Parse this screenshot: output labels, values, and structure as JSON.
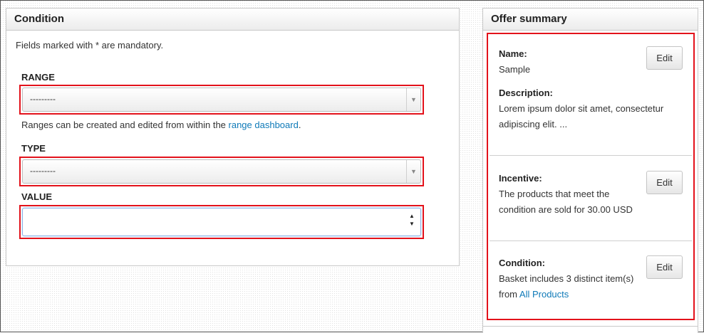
{
  "condition_panel": {
    "title": "Condition",
    "mandatory_note": "Fields marked with * are mandatory.",
    "range": {
      "label": "RANGE",
      "selected": "---------"
    },
    "help_prefix": "Ranges can be created and edited from within the ",
    "help_link": "range dashboard",
    "help_suffix": ".",
    "type": {
      "label": "TYPE",
      "selected": "---------"
    },
    "value": {
      "label": "VALUE",
      "current": ""
    }
  },
  "offer_summary": {
    "title": "Offer summary",
    "name_label": "Name:",
    "name_value": "Sample",
    "description_label": "Description:",
    "description_value": "Lorem ipsum dolor sit amet, consectetur adipiscing elit. ...",
    "incentive_label": "Incentive:",
    "incentive_value": "The products that meet the condition are sold for 30.00 USD",
    "condition_label": "Condition:",
    "condition_prefix": "Basket includes 3 distinct item(s) from ",
    "condition_link": "All Products",
    "edit_label": "Edit"
  },
  "icons": {
    "select_arrow": "chevron-down-icon",
    "spin_up": "spin-up-icon",
    "spin_down": "spin-down-icon"
  },
  "colors": {
    "highlight": "#e3121b",
    "link": "#0f7ab8"
  }
}
